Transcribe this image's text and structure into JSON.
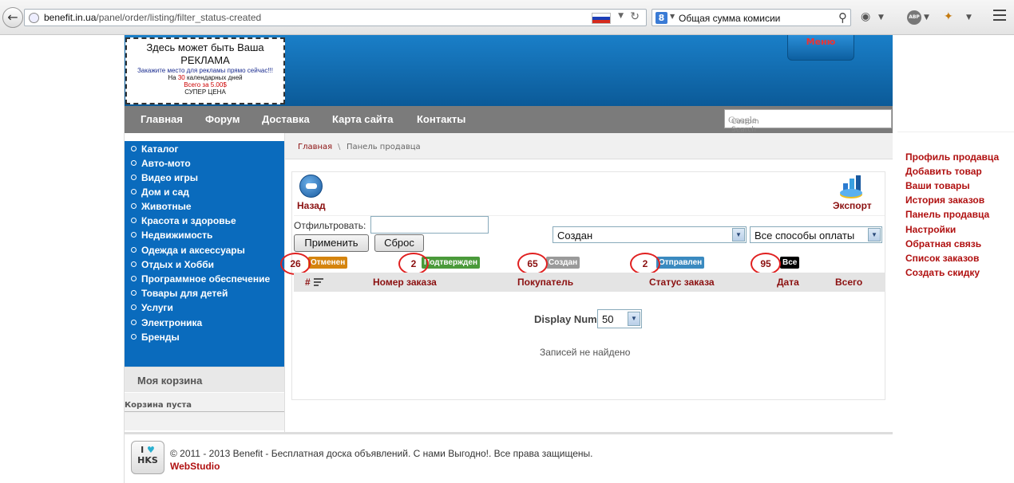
{
  "browser": {
    "url_host": "benefit.in.ua",
    "url_path": "/panel/order/listing/filter_status-created",
    "search_engine": "8",
    "search_text": "Общая сумма комисии"
  },
  "ad": {
    "title": "Здесь может быть Ваша РЕКЛАМА",
    "subtitle": "Закажите место для рекламы прямо сейчас!!!",
    "line_pre": "На",
    "days": "30",
    "line_post": "календарных дней",
    "price": "Всего за 5.00$",
    "super": "СУПЕР ЦЕНА"
  },
  "header": {
    "menu_tab": "Меню"
  },
  "nav": [
    "Главная",
    "Форум",
    "Доставка",
    "Карта сайта",
    "Контакты"
  ],
  "search": {
    "brand": "Google",
    "placeholder": "Custom Search"
  },
  "categories": [
    "Каталог",
    "Авто-мото",
    "Видео игры",
    "Дом и сад",
    "Животные",
    "Красота и здоровье",
    "Недвижимость",
    "Одежда и аксессуары",
    "Отдых и Хобби",
    "Программное обеспечение",
    "Товары для детей",
    "Услуги",
    "Электроника",
    "Бренды"
  ],
  "cart": {
    "title": "Моя корзина",
    "empty": "Корзина пуста"
  },
  "breadcrumb": {
    "home": "Главная",
    "sep": "\\",
    "current": "Панель продавца"
  },
  "toolbar": {
    "back": "Назад",
    "export": "Экспорт"
  },
  "filter": {
    "label": "Отфильтровать:",
    "value": "",
    "apply": "Применить",
    "reset": "Сброс",
    "status_selected": "Создан",
    "payment_selected": "Все способы оплаты"
  },
  "statuses": [
    {
      "count": "26",
      "label": "Отменен"
    },
    {
      "count": "2",
      "label": "Подтвержден"
    },
    {
      "count": "65",
      "label": "Создан"
    },
    {
      "count": "2",
      "label": "Отправлен"
    },
    {
      "count": "95",
      "label": "Все"
    }
  ],
  "table": {
    "headers": [
      "#",
      "Номер заказа",
      "Покупатель",
      "Статус заказа",
      "Дата",
      "Всего"
    ]
  },
  "pagination": {
    "label": "Display Num",
    "value": "50"
  },
  "empty_text": "Записей не найдено",
  "footer": {
    "logo_top": "I",
    "logo_bottom": "HKS",
    "text": "© 2011 - 2013 Benefit - Бесплатная доска объявлений. С нами Выгодно!. Все права защищены.",
    "brand": "WebStudio"
  },
  "right_menu": [
    "Профиль продавца",
    "Добавить товар",
    "Ваши товары",
    "История заказов",
    "Панель продавца",
    "Настройки",
    "Обратная связь",
    "Список заказов",
    "Создать скидку"
  ],
  "colors": {
    "link": "#8b1010",
    "header_blue": "#0b5a98",
    "sidebar_blue": "#0a6bbd",
    "nav_gray": "#7b7b7b"
  }
}
